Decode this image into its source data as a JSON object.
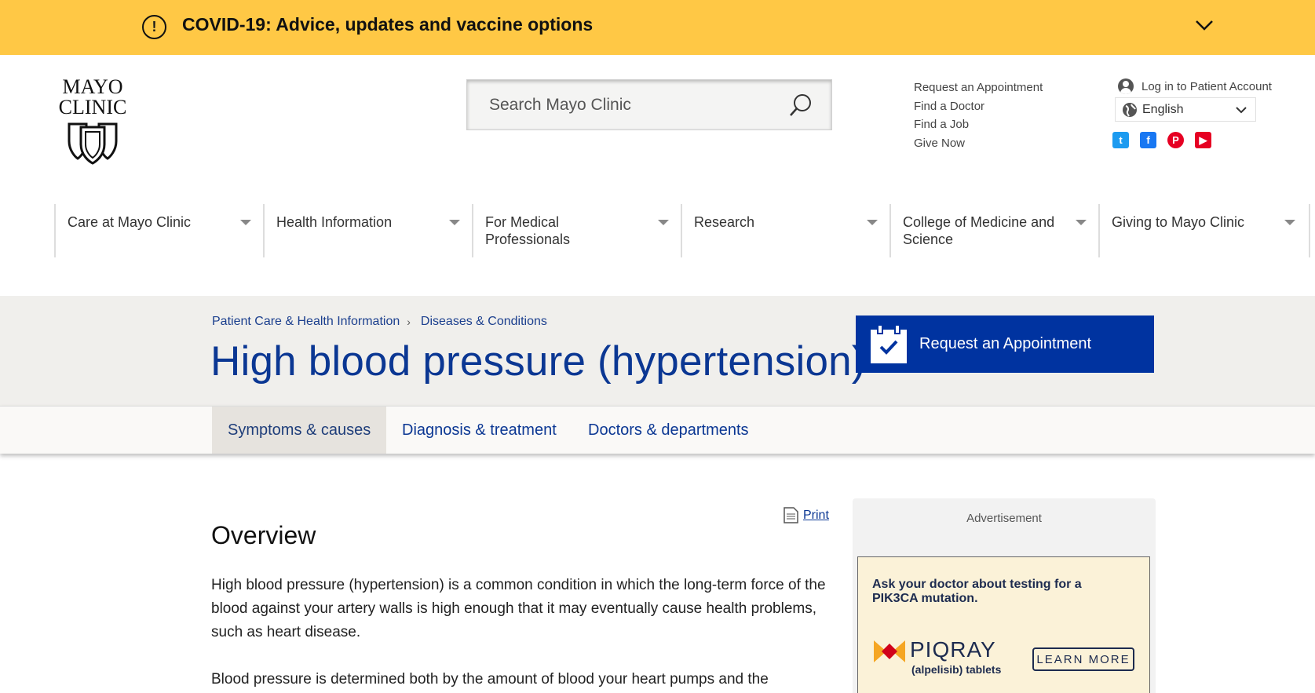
{
  "banner": {
    "title": "COVID-19: Advice, updates and vaccine options",
    "alert_symbol": "!"
  },
  "logo": {
    "line1": "MAYO",
    "line2": "CLINIC"
  },
  "search": {
    "placeholder": "Search Mayo Clinic"
  },
  "utility_links": [
    "Request an Appointment",
    "Find a Doctor",
    "Find a Job",
    "Give Now"
  ],
  "account": {
    "login": "Log in to Patient Account",
    "language": "English"
  },
  "social": {
    "twitter": "t",
    "facebook": "f",
    "pinterest": "P",
    "youtube": "▶"
  },
  "nav": [
    {
      "label": "Care at Mayo Clinic"
    },
    {
      "label": "Health Information"
    },
    {
      "label": "For Medical Professionals"
    },
    {
      "label": "Research"
    },
    {
      "label": "College of Medicine and Science"
    },
    {
      "label": "Giving to Mayo Clinic"
    }
  ],
  "breadcrumb": {
    "item1": "Patient Care & Health Information",
    "separator": "›",
    "item2": "Diseases & Conditions"
  },
  "page": {
    "title": "High blood pressure (hypertension)"
  },
  "request_button": {
    "label": "Request an Appointment"
  },
  "tabs": [
    {
      "label": "Symptoms & causes",
      "active": true
    },
    {
      "label": "Diagnosis & treatment",
      "active": false
    },
    {
      "label": "Doctors & departments",
      "active": false
    }
  ],
  "content": {
    "print": "Print",
    "heading": "Overview",
    "p1": "High blood pressure (hypertension) is a common condition in which the long-term force of the blood against your artery walls is high enough that it may eventually cause health problems, such as heart disease.",
    "p2": "Blood pressure is determined both by the amount of blood your heart pumps and the"
  },
  "ad": {
    "label": "Advertisement",
    "question": "Ask your doctor about testing for a PIK3CA mutation.",
    "brand": "PIQRAY",
    "brand_sub": "(alpelisib) tablets",
    "cta": "LEARN MORE"
  },
  "colors": {
    "banner": "#ffc845",
    "brand_blue": "#0033a0",
    "title_blue": "#0b3793"
  }
}
